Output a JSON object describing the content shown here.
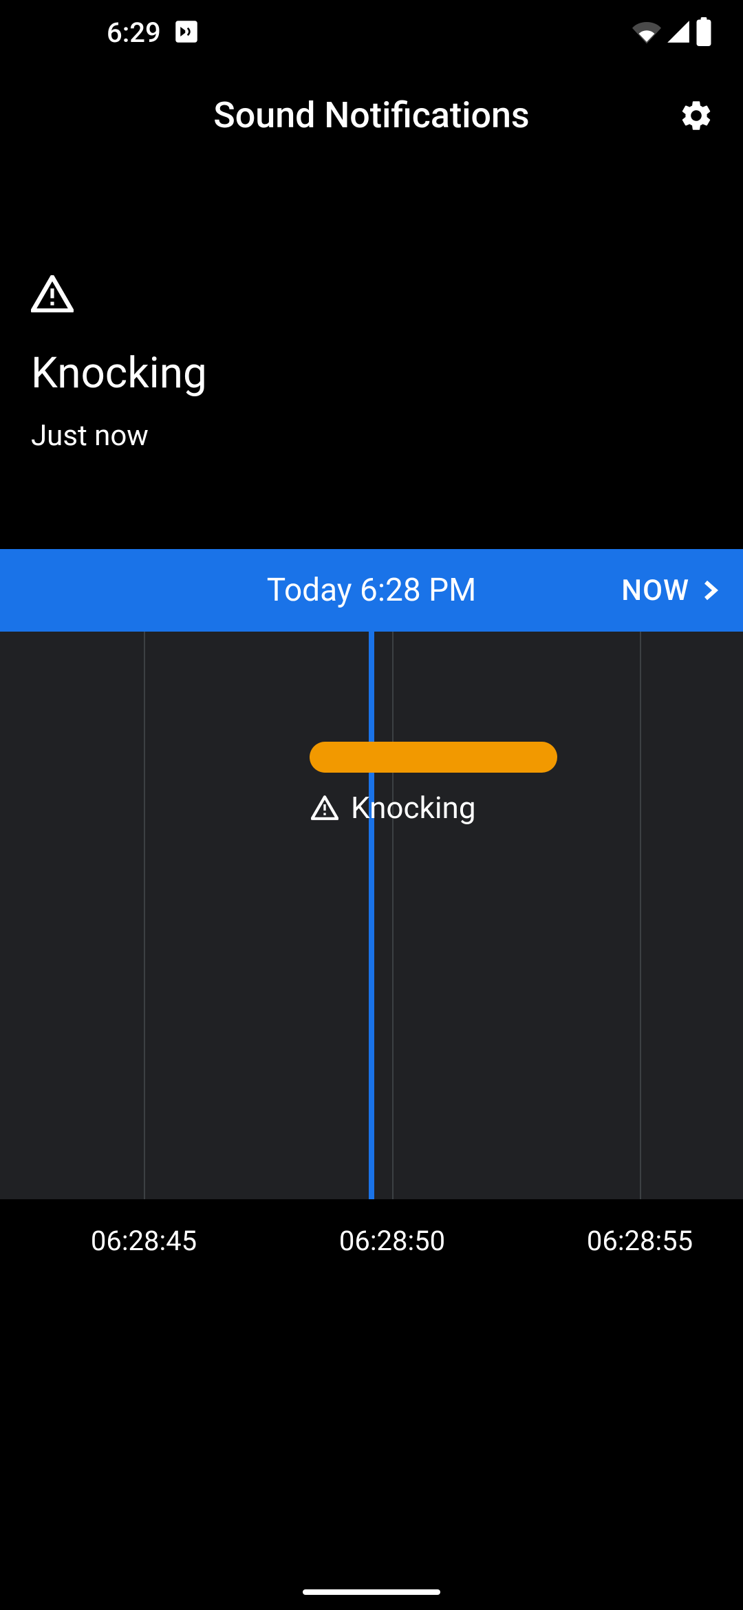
{
  "status": {
    "time": "6:29"
  },
  "app": {
    "title": "Sound Notifications"
  },
  "detection": {
    "label": "Knocking",
    "time": "Just now"
  },
  "timebar": {
    "center": "Today 6:28 PM",
    "now": "NOW"
  },
  "event": {
    "label": "Knocking"
  },
  "ticks": {
    "t0": "06:28:45",
    "t1": "06:28:50",
    "t2": "06:28:55"
  }
}
